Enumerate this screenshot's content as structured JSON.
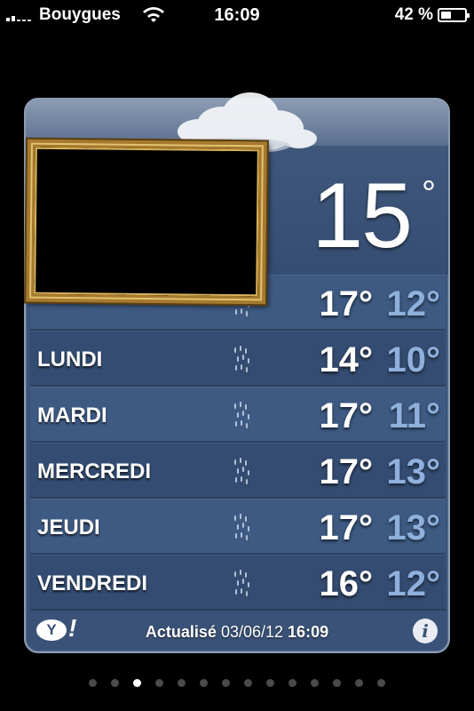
{
  "status_bar": {
    "carrier": "Bouygues",
    "time": "16:09",
    "battery_percent": "42 %",
    "battery_level": 0.42,
    "signal_icon": "signal-bars-icon",
    "wifi_icon": "wifi-icon"
  },
  "weather": {
    "current_temp": "15",
    "current_unit": "°",
    "forecast": [
      {
        "day": "",
        "high": "17°",
        "low": "12°",
        "icon": "rain-icon"
      },
      {
        "day": "LUNDI",
        "high": "14°",
        "low": "10°",
        "icon": "rain-icon"
      },
      {
        "day": "MARDI",
        "high": "17°",
        "low": "11°",
        "icon": "rain-icon"
      },
      {
        "day": "MERCREDI",
        "high": "17°",
        "low": "13°",
        "icon": "rain-icon"
      },
      {
        "day": "JEUDI",
        "high": "17°",
        "low": "13°",
        "icon": "rain-icon"
      },
      {
        "day": "VENDREDI",
        "high": "16°",
        "low": "12°",
        "icon": "rain-icon"
      }
    ],
    "footer": {
      "updated_label": "Actualisé",
      "updated_date": "03/06/12",
      "updated_time": "16:09",
      "yahoo_logo": "Y",
      "yahoo_bang": "!",
      "info_icon": "i"
    }
  },
  "pager": {
    "total": 14,
    "active_index": 2
  },
  "colors": {
    "low_temp": "#8fb0dc",
    "card_bg": "#3a5277"
  }
}
